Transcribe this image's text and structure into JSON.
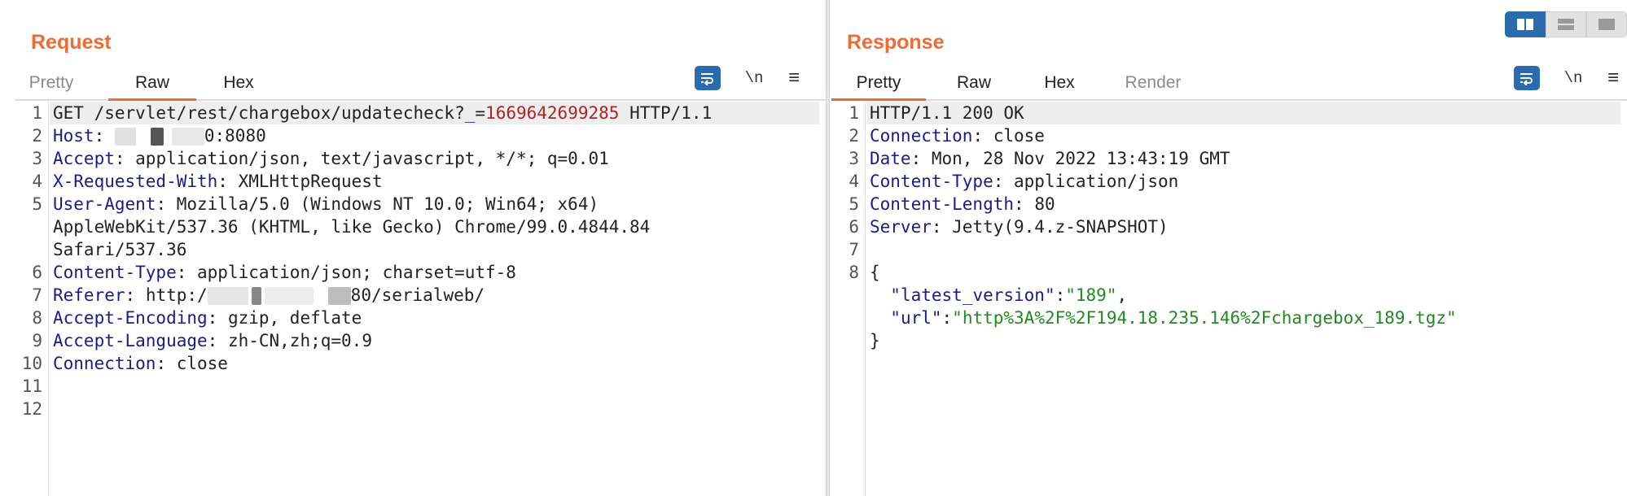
{
  "request": {
    "title": "Request",
    "tabs": [
      "Pretty",
      "Raw",
      "Hex"
    ],
    "active_tab": "Raw",
    "tools": {
      "newline_label": "\\n",
      "menu_glyph": "≡"
    },
    "line_numbers": [
      "1",
      "2",
      "3",
      "4",
      "5",
      "",
      "",
      "6",
      "7",
      "8",
      "9",
      "10",
      "11",
      "12"
    ],
    "lines": {
      "l1_method_path": "GET /servlet/rest/chargebox/updatecheck?",
      "l1_param": "_",
      "l1_eq": "=",
      "l1_value": "1669642699285",
      "l1_proto": " HTTP/1.1",
      "h_host_name": "Host",
      "h_host_value_tail": "0:8080",
      "h_accept_name": "Accept",
      "h_accept_value": "application/json, text/javascript, */*; q=0.01",
      "h_xrw_name": "X-Requested-With",
      "h_xrw_value": "XMLHttpRequest",
      "h_ua_name": "User-Agent",
      "h_ua_value_1": "Mozilla/5.0 (Windows NT 10.0; Win64; x64)",
      "h_ua_value_2": "AppleWebKit/537.36 (KHTML, like Gecko) Chrome/99.0.4844.84",
      "h_ua_value_3": "Safari/537.36",
      "h_ct_name": "Content-Type",
      "h_ct_value": "application/json; charset=utf-8",
      "h_ref_name": "Referer",
      "h_ref_value_head": "http:/",
      "h_ref_value_tail": "80/serialweb/",
      "h_ae_name": "Accept-Encoding",
      "h_ae_value": "gzip, deflate",
      "h_al_name": "Accept-Language",
      "h_al_value": "zh-CN,zh;q=0.9",
      "h_conn_name": "Connection",
      "h_conn_value": "close"
    }
  },
  "response": {
    "title": "Response",
    "tabs": [
      "Pretty",
      "Raw",
      "Hex",
      "Render"
    ],
    "active_tab": "Pretty",
    "tools": {
      "newline_label": "\\n",
      "menu_glyph": "≡"
    },
    "line_numbers": [
      "1",
      "2",
      "3",
      "4",
      "5",
      "6",
      "7",
      "8",
      "",
      "",
      ""
    ],
    "lines": {
      "status": "HTTP/1.1 200 OK",
      "h_conn_name": "Connection",
      "h_conn_value": "close",
      "h_date_name": "Date",
      "h_date_value": "Mon, 28 Nov 2022 13:43:19 GMT",
      "h_ct_name": "Content-Type",
      "h_ct_value": "application/json",
      "h_cl_name": "Content-Length",
      "h_cl_value": "80",
      "h_server_name": "Server",
      "h_server_value": "Jetty(9.4.z-SNAPSHOT)",
      "brace_open": "{",
      "json_key_1": "\"latest_version\"",
      "json_val_1": "\"189\"",
      "json_key_2": "\"url\"",
      "json_val_2": "\"http%3A%2F%2F194.18.235.146%2Fchargebox_189.tgz\"",
      "brace_close": "}"
    }
  },
  "colors": {
    "accent": "#f06a35",
    "toolbar_blue": "#2a6bb0",
    "header_name": "#1a1a8c",
    "number": "#b22222",
    "json_string": "#1f8a1f"
  }
}
